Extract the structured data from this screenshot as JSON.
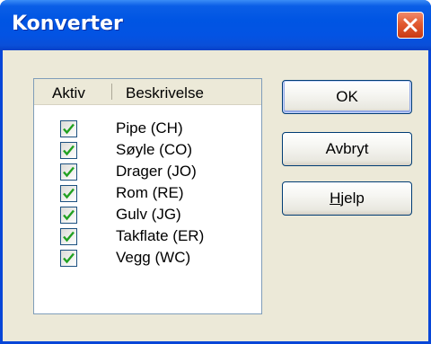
{
  "window": {
    "title": "Konverter"
  },
  "list": {
    "columns": [
      "Aktiv",
      "Beskrivelse"
    ],
    "items": [
      {
        "label": "Pipe (CH)",
        "checked": true
      },
      {
        "label": "Søyle (CO)",
        "checked": true
      },
      {
        "label": "Drager (JO)",
        "checked": true
      },
      {
        "label": "Rom (RE)",
        "checked": true
      },
      {
        "label": "Gulv (JG)",
        "checked": true
      },
      {
        "label": "Takflate (ER)",
        "checked": true
      },
      {
        "label": "Vegg (WC)",
        "checked": true
      }
    ]
  },
  "buttons": {
    "ok": "OK",
    "cancel": "Avbryt",
    "help_mnemonic": "H",
    "help_rest": "jelp"
  },
  "icons": {
    "close": "close-icon",
    "check": "checkmark-icon"
  },
  "colors": {
    "titlebar": "#0055e3",
    "dialog_bg": "#ece9d8",
    "close_button": "#e25a2f",
    "checkmark": "#21a121"
  }
}
